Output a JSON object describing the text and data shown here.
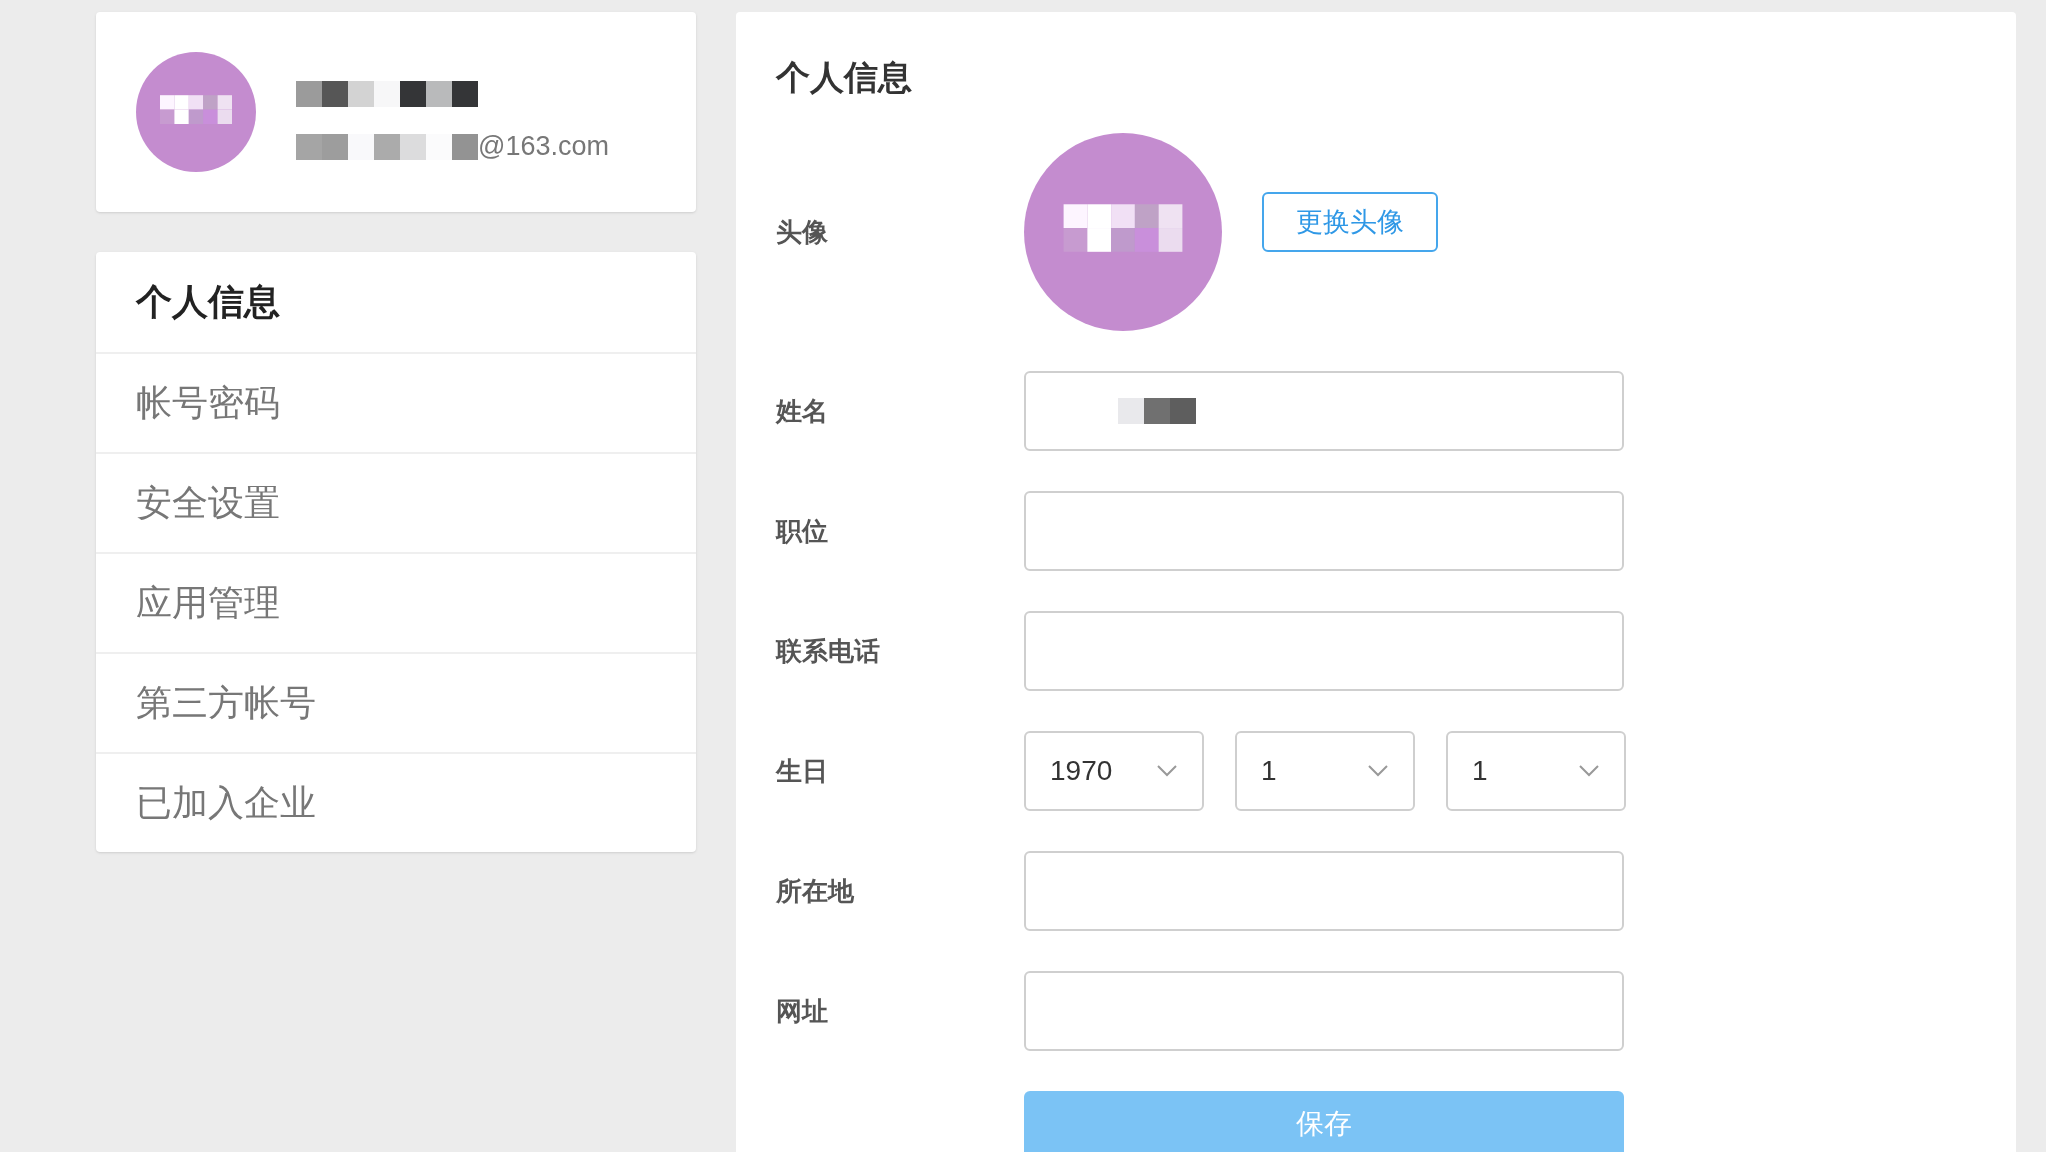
{
  "profile": {
    "email_suffix": "@163.com"
  },
  "menu": [
    {
      "label": "个人信息",
      "selected": true
    },
    {
      "label": "帐号密码",
      "selected": false
    },
    {
      "label": "安全设置",
      "selected": false
    },
    {
      "label": "应用管理",
      "selected": false
    },
    {
      "label": "第三方帐号",
      "selected": false
    },
    {
      "label": "已加入企业",
      "selected": false
    }
  ],
  "panel": {
    "title": "个人信息",
    "avatar_label": "头像",
    "change_avatar_button": "更换头像",
    "fields": [
      {
        "kind": "text",
        "label": "姓名",
        "redacted": true
      },
      {
        "kind": "text",
        "label": "职位"
      },
      {
        "kind": "text",
        "label": "联系电话"
      },
      {
        "kind": "date",
        "label": "生日",
        "selects": [
          "1970",
          "1",
          "1"
        ]
      },
      {
        "kind": "text",
        "label": "所在地"
      },
      {
        "kind": "text",
        "label": "网址"
      }
    ],
    "save_button": "保存"
  }
}
